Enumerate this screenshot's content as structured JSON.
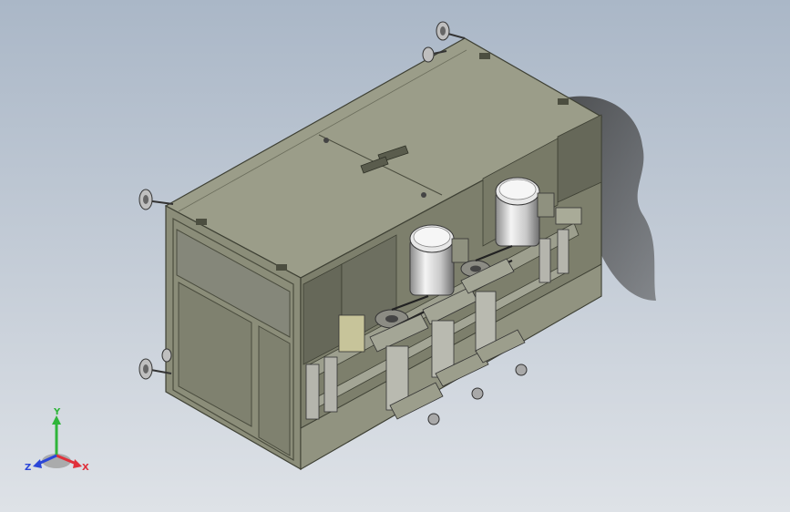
{
  "viewport": {
    "background_top": "#aab7c7",
    "background_bottom": "#dee2e7"
  },
  "model": {
    "body_color": "#8b8d79",
    "body_dark": "#5f6152",
    "top_color": "#9b9d89",
    "panel_color": "#666859",
    "motor_color": "#dcdcdc",
    "motor_count": 2
  },
  "triad": {
    "x_label": "X",
    "y_label": "Y",
    "z_label": "Z",
    "x_color": "#e0303a",
    "y_color": "#2fb53a",
    "z_color": "#2b46d8"
  }
}
